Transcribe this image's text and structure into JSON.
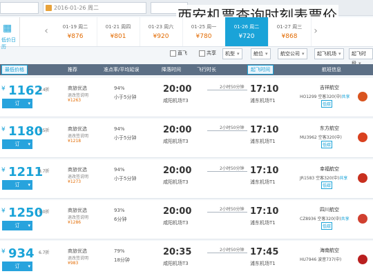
{
  "title": "西安机票查询时刻表票价",
  "search": {
    "date": "2016-01-26",
    "weekday": "周二"
  },
  "datestrip": {
    "left_label": "低价日历",
    "items": [
      {
        "date": "01-19 周二",
        "price": "¥876"
      },
      {
        "date": "01-21 周四",
        "price": "¥801"
      },
      {
        "date": "01-23 周六",
        "price": "¥920"
      },
      {
        "date": "01-25 周一",
        "price": "¥780"
      },
      {
        "date": "01-26 周二",
        "price": "¥720"
      },
      {
        "date": "01-27 周三",
        "price": "¥868"
      }
    ]
  },
  "filters": {
    "direct": "直飞",
    "shared": "共享",
    "depart_time": "起飞时段",
    "arrive_airport": "降落机场",
    "airline": "航空公司",
    "cabin": "舱位",
    "aircraft": "机型",
    "depart_airport": "起飞机场"
  },
  "header": {
    "price": "最低价格",
    "recommend": "推荐",
    "punctuality": "准点率/平均延误",
    "arrive_time": "降落时间",
    "duration": "飞行时长",
    "depart_time": "起飞时间",
    "flight_info": "航班信息"
  },
  "flights": [
    {
      "price": "1162",
      "disc": "8.4折",
      "book": "订",
      "policy1": "商旅优选",
      "policy2": "退改签说明",
      "policy3": "¥1263",
      "rate": "94%",
      "dur2": "小于5分钟",
      "arr": "20:00",
      "arrap": "咸阳机场T3",
      "dur": "2小时50分钟",
      "dep": "17:10",
      "depap": "浦东机场T1",
      "airline": "吉祥航空",
      "fno": "HO1299 空客320(中)",
      "share": "共享",
      "badge": "低碳"
    },
    {
      "price": "1180",
      "disc": "8.5折",
      "book": "订",
      "policy1": "商旅优选",
      "policy2": "退改签说明",
      "policy3": "¥1218",
      "rate": "94%",
      "dur2": "小于5分钟",
      "arr": "20:00",
      "arrap": "咸阳机场T3",
      "dur": "2小时50分钟",
      "dep": "17:10",
      "depap": "浦东机场T1",
      "airline": "东方航空",
      "fno": "MU3962 空客320(中)",
      "share": "",
      "badge": "低碳"
    },
    {
      "price": "1211",
      "disc": "8.7折",
      "book": "订",
      "policy1": "商旅优选",
      "policy2": "退改签说明",
      "policy3": "¥1273",
      "rate": "94%",
      "dur2": "小于5分钟",
      "arr": "20:00",
      "arrap": "咸阳机场T3",
      "dur": "2小时50分钟",
      "dep": "17:10",
      "depap": "浦东机场T1",
      "airline": "幸福航空",
      "fno": "JR1583 空客320(中)",
      "share": "共享",
      "badge": "低碳"
    },
    {
      "price": "1250",
      "disc": "9.0折",
      "book": "订",
      "policy1": "商旅优选",
      "policy2": "退改签说明",
      "policy3": "¥1286",
      "rate": "93%",
      "dur2": "6分钟",
      "arr": "20:00",
      "arrap": "咸阳机场T3",
      "dur": "2小时50分钟",
      "dep": "17:10",
      "depap": "浦东机场T1",
      "airline": "四川航空",
      "fno": "CZ8936 空客320(中)",
      "share": "共享",
      "badge": "低碳"
    },
    {
      "price": "934",
      "disc": "6.7折",
      "book": "订",
      "policy1": "商旅优选",
      "policy2": "退改签说明",
      "policy3": "¥983",
      "rate": "79%",
      "dur2": "18分钟",
      "arr": "20:35",
      "arrap": "咸阳机场T3",
      "dur": "2小时50分钟",
      "dep": "17:45",
      "depap": "浦东机场T1",
      "airline": "海南航空",
      "fno": "HU7946 波音737(中)",
      "share": "",
      "badge": ""
    }
  ],
  "colors": {
    "accent": "#1aa3d8",
    "header": "#5c6f85",
    "orange": "#e26a00"
  }
}
